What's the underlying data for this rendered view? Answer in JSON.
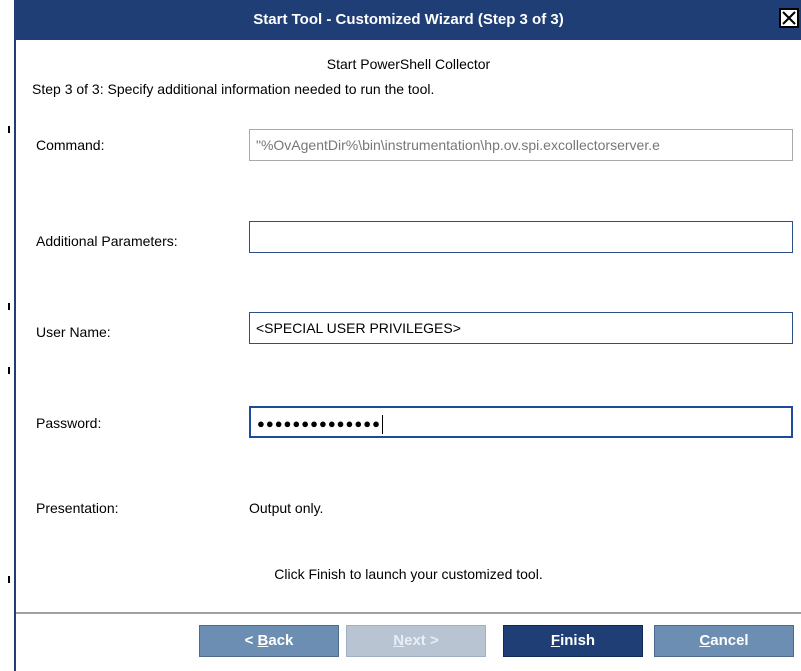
{
  "dialog": {
    "title": "Start Tool - Customized Wizard (Step 3 of 3)",
    "subtitle": "Start PowerShell Collector",
    "step_text": "Step 3 of 3: Specify additional information needed to run the tool.",
    "colors": {
      "titlebar": "#1f3e75",
      "button": "#6c8eb3",
      "button_primary": "#1f3e75",
      "button_disabled": "#b8c4d2"
    }
  },
  "form": {
    "command": {
      "label": "Command:",
      "value": "\"%OvAgentDir%\\bin\\instrumentation\\hp.ov.spi.excollectorserver.e"
    },
    "additional_parameters": {
      "label": "Additional Parameters:",
      "value": ""
    },
    "user_name": {
      "label": "User Name:",
      "value": "<SPECIAL USER PRIVILEGES>"
    },
    "password": {
      "label": "Password:",
      "value": "●●●●●●●●●●●●●●"
    },
    "presentation": {
      "label": "Presentation:",
      "value": "Output only."
    }
  },
  "hint": "Click Finish to launch your customized tool.",
  "buttons": {
    "back": {
      "prefix": "< ",
      "mnemonic": "B",
      "rest": "ack",
      "enabled": true
    },
    "next": {
      "mnemonic": "N",
      "rest": "ext >",
      "enabled": false
    },
    "finish": {
      "mnemonic": "F",
      "rest": "inish",
      "enabled": true
    },
    "cancel": {
      "mnemonic": "C",
      "rest": "ancel",
      "enabled": true
    }
  }
}
